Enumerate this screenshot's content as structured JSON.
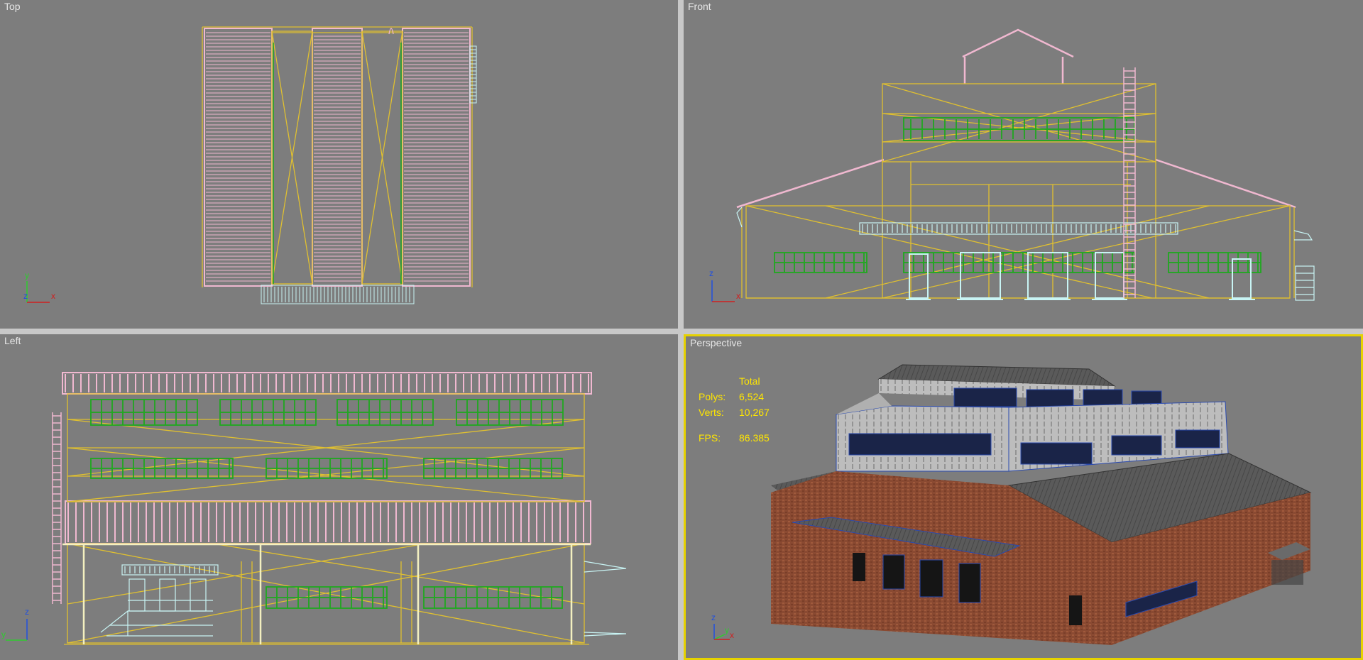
{
  "viewports": {
    "top": {
      "label": "Top"
    },
    "front": {
      "label": "Front"
    },
    "left": {
      "label": "Left"
    },
    "perspective": {
      "label": "Perspective"
    }
  },
  "stats": {
    "header": "Total",
    "polys_label": "Polys:",
    "polys_value": "6,524",
    "verts_label": "Verts:",
    "verts_value": "10,267",
    "fps_label": "FPS:",
    "fps_value": "86.385"
  },
  "axes": {
    "top": [
      "y",
      "x",
      "z"
    ],
    "front": [
      "z",
      "x"
    ],
    "left": [
      "z",
      "y"
    ],
    "perspective": [
      "z",
      "y",
      "x"
    ]
  },
  "colors": {
    "viewport_bg": "#7d7d7d",
    "separator": "#c8c8c8",
    "active_border": "#e6d200",
    "wire_yellow": "#e0c030",
    "wire_pink": "#f0b8d0",
    "wire_green": "#1fa81f",
    "wire_cyan": "#c8f4f4",
    "stats_text": "#ffe600"
  }
}
